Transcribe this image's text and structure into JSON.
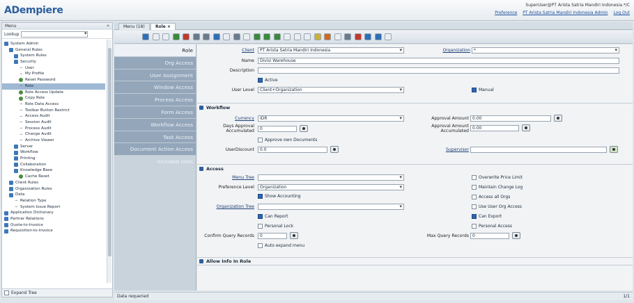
{
  "header": {
    "logo": "ADempiere",
    "user_line": "SuperUser@PT Arista Satria Mandiri Indonesia.*/C",
    "links": [
      "Preference",
      "PT Arista Satria Mandiri Indonesia Admin",
      "Log Out"
    ]
  },
  "menu": {
    "title": "Menu",
    "lookup_label": "Lookup",
    "tree": [
      {
        "label": "System Admin",
        "level": 0,
        "kind": "folder"
      },
      {
        "label": "General Rules",
        "level": 1,
        "kind": "folder"
      },
      {
        "label": "System Rules",
        "level": 2,
        "kind": "folder"
      },
      {
        "label": "Security",
        "level": 2,
        "kind": "folder"
      },
      {
        "label": "User",
        "level": 3,
        "kind": "leaf"
      },
      {
        "label": "My Profile",
        "level": 3,
        "kind": "leaf"
      },
      {
        "label": "Reset Password",
        "level": 3,
        "kind": "proc"
      },
      {
        "label": "Role",
        "level": 3,
        "kind": "leaf",
        "selected": true
      },
      {
        "label": "Role Access Update",
        "level": 3,
        "kind": "proc"
      },
      {
        "label": "Copy Role",
        "level": 3,
        "kind": "proc"
      },
      {
        "label": "Role Data Access",
        "level": 3,
        "kind": "leaf"
      },
      {
        "label": "Toolbar Button Restrict",
        "level": 3,
        "kind": "leaf"
      },
      {
        "label": "Access Audit",
        "level": 3,
        "kind": "leaf"
      },
      {
        "label": "Session Audit",
        "level": 3,
        "kind": "leaf"
      },
      {
        "label": "Process Audit",
        "level": 3,
        "kind": "leaf"
      },
      {
        "label": "Change Audit",
        "level": 3,
        "kind": "leaf"
      },
      {
        "label": "Archive Viewer",
        "level": 3,
        "kind": "leaf"
      },
      {
        "label": "Server",
        "level": 2,
        "kind": "folder"
      },
      {
        "label": "Workflow",
        "level": 2,
        "kind": "folder"
      },
      {
        "label": "Printing",
        "level": 2,
        "kind": "folder"
      },
      {
        "label": "Collaboration",
        "level": 2,
        "kind": "folder"
      },
      {
        "label": "Knowledge Base",
        "level": 2,
        "kind": "folder"
      },
      {
        "label": "Cache Reset",
        "level": 3,
        "kind": "proc"
      },
      {
        "label": "Client Rules",
        "level": 1,
        "kind": "folder"
      },
      {
        "label": "Organization Rules",
        "level": 1,
        "kind": "folder"
      },
      {
        "label": "Data",
        "level": 1,
        "kind": "folder"
      },
      {
        "label": "Relation Type",
        "level": 2,
        "kind": "leaf"
      },
      {
        "label": "System Issue Report",
        "level": 2,
        "kind": "leaf"
      },
      {
        "label": "Application Dictionary",
        "level": 0,
        "kind": "folder"
      },
      {
        "label": "Partner Relations",
        "level": 0,
        "kind": "folder"
      },
      {
        "label": "Quote-to-Invoice",
        "level": 0,
        "kind": "folder"
      },
      {
        "label": "Requisition-to-Invoice",
        "level": 0,
        "kind": "folder"
      }
    ],
    "expand_tree": "Expand Tree"
  },
  "tabs": [
    {
      "label": "Menu (18)",
      "active": false
    },
    {
      "label": "Role ×",
      "active": true
    }
  ],
  "toolbar_icons": [
    "help-icon",
    "new-record-icon",
    "copy-record-icon",
    "save-icon",
    "delete-icon",
    "refresh-icon",
    "find-icon",
    "attachment-icon",
    "chat-icon",
    "grid-toggle-icon",
    "history-icon",
    "first-record-icon",
    "previous-record-icon",
    "next-record-icon",
    "last-record-icon",
    "parent-record-icon",
    "detail-record-icon",
    "report-icon",
    "archive-icon",
    "print-icon",
    "zoom-across-icon",
    "active-workflows-icon",
    "requests-icon",
    "product-info-icon",
    "process-icon"
  ],
  "tablist": [
    "Role",
    "Org Access",
    "User Assignment",
    "Window Access",
    "Process Access",
    "Form Access",
    "Workflow Access",
    "Task Access",
    "Document Action Access",
    "Included roles"
  ],
  "form": {
    "client_label": "Client",
    "client_value": "PT Arista Satria Mandiri Indonesia",
    "organization_label": "Organization",
    "organization_value": "*",
    "name_label": "Name",
    "name_value": "Divisi Warehouse",
    "description_label": "Description",
    "description_value": "",
    "active_label": "Active",
    "user_level_label": "User Level",
    "user_level_value": "Client+Organization",
    "manual_label": "Manual",
    "workflow_title": "Workflow",
    "currency_label": "Currency",
    "currency_value": "IDR",
    "approval_amount_label": "Approval Amount",
    "approval_amount_value": "0.00",
    "days_approval_label_1": "Days Approval",
    "days_approval_label_2": "Accumulated",
    "days_approval_value": "0",
    "approval_amount_acc_label_1": "Approval Amount",
    "approval_amount_acc_label_2": "Accumulated",
    "approval_amount_acc_value": "0.00",
    "approve_own_label": "Approve own Documents",
    "user_discount_label": "UserDiscount",
    "user_discount_value": "0.0",
    "supervisor_label": "Supervisor",
    "supervisor_value": "",
    "access_title": "Access",
    "menu_tree_label": "Menu Tree",
    "menu_tree_value": "",
    "overwrite_price_label": "Overwrite Price Limit",
    "preference_level_label": "Preference Level",
    "preference_level_value": "Organization",
    "maintain_change_log_label": "Maintain Change Log",
    "show_accounting_label": "Show Accounting",
    "access_all_orgs_label": "Access all Orgs",
    "organization_tree_label": "Organization Tree",
    "organization_tree_value": "",
    "use_user_org_label": "Use User Org Access",
    "can_report_label": "Can Report",
    "can_export_label": "Can Export",
    "personal_lock_label": "Personal Lock",
    "personal_access_label": "Personal Access",
    "confirm_query_label": "Confirm Query Records",
    "confirm_query_value": "0",
    "max_query_label": "Max Query Records",
    "max_query_value": "0",
    "auto_expand_label": "Auto expand menu",
    "allow_info_title": "Allow Info In Role"
  },
  "status": {
    "message": "Data requeried",
    "record": "1/1"
  }
}
